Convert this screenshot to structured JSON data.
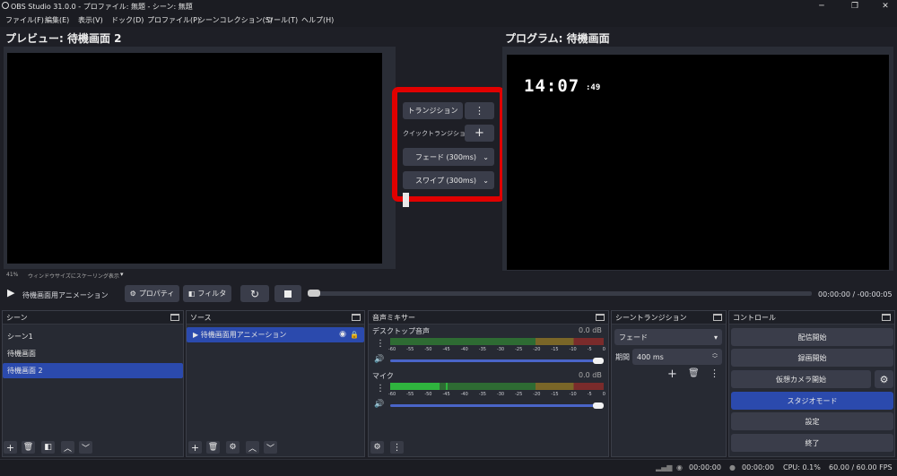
{
  "title": "OBS Studio 31.0.0 - プロファイル: 無題 - シーン: 無題",
  "menu": [
    "ファイル(F)",
    "編集(E)",
    "表示(V)",
    "ドック(D)",
    "プロファイル(P)",
    "シーンコレクション(S)",
    "ツール(T)",
    "ヘルプ(H)"
  ],
  "preview": {
    "title": "プレビュー: 待機画面 2",
    "zoom": "41%",
    "scaling": "ウィンドウサイズにスケーリング表示"
  },
  "program": {
    "title": "プログラム: 待機画面",
    "clock_hm": "14:07",
    "clock_s": ":49"
  },
  "transition": {
    "button": "トランジション",
    "quick": "クイックトランジション",
    "fade": "フェード (300ms)",
    "swipe": "スワイプ (300ms)"
  },
  "media": {
    "name": "待機画面用アニメーション",
    "properties": "プロパティ",
    "filters": "フィルタ",
    "time": "00:00:00  /  -00:00:05"
  },
  "scenes": {
    "title": "シーン",
    "items": [
      "シーン1",
      "待機画面",
      "待機画面 2"
    ]
  },
  "sources": {
    "title": "ソース",
    "items": [
      "待機画面用アニメーション"
    ]
  },
  "mixer": {
    "title": "音声ミキサー",
    "channels": [
      {
        "name": "デスクトップ音声",
        "db": "0.0 dB"
      },
      {
        "name": "マイク",
        "db": "0.0 dB"
      }
    ],
    "scale": [
      "-60",
      "-55",
      "-50",
      "-45",
      "-40",
      "-35",
      "-30",
      "-25",
      "-20",
      "-15",
      "-10",
      "-5",
      "0"
    ]
  },
  "scene_transition": {
    "title": "シーントランジション",
    "type": "フェード",
    "duration_label": "期間",
    "duration": "400 ms"
  },
  "controls": {
    "title": "コントロール",
    "stream": "配信開始",
    "record": "録画開始",
    "vcam": "仮想カメラ開始",
    "studio": "スタジオモード",
    "settings": "設定",
    "exit": "終了"
  },
  "status": {
    "stream_time": "00:00:00",
    "rec_time": "00:00:00",
    "cpu": "CPU: 0.1%",
    "fps": "60.00 / 60.00 FPS"
  },
  "colors": {
    "accent": "#2b4aad",
    "highlight": "#e10000"
  }
}
